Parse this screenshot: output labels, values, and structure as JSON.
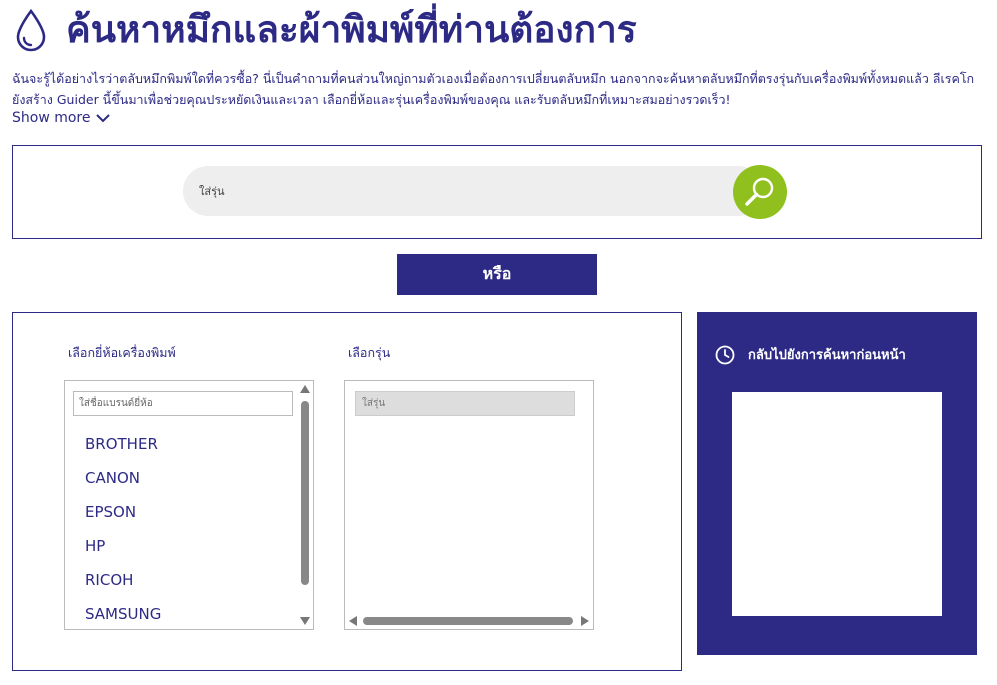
{
  "header": {
    "title": "ค้นหาหมึกและผ้าพิมพ์ที่ท่านต้องการ"
  },
  "intro": {
    "text": "ฉันจะรู้ได้อย่างไรว่าตลับหมึกพิมพ์ใดที่ควรซื้อ?    นี่เป็นคำถามที่คนส่วนใหญ่ถามตัวเองเมื่อต้องการเปลี่ยนตลับหมึก    นอกจากจะค้นหาตลับหมึกที่ตรงรุ่นกับเครื่องพิมพ์ทั้งหมดแล้ว ลีเรคโกยังสร้าง Guider นี้ขึ้นมาเพื่อช่วยคุณประหยัดเงินและเวลา เลือกยี่ห้อและรุ่นเครื่องพิมพ์ของคุณ และรับตลับหมึกที่เหมาะสมอย่างรวดเร็ว!",
    "show_more": "Show more"
  },
  "search": {
    "placeholder": "ใส่รุ่น"
  },
  "or_button": "หรือ",
  "brand_select": {
    "label": "เลือกยี่ห้อเครื่องพิมพ์",
    "placeholder": "ใส่ชื่อแบรนด์ยี่ห้อ",
    "items": [
      "BROTHER",
      "CANON",
      "EPSON",
      "HP",
      "RICOH",
      "SAMSUNG"
    ]
  },
  "model_select": {
    "label": "เลือกรุ่น",
    "placeholder": "ใส่รุ่น"
  },
  "history": {
    "title": "กลับไปยังการค้นหาก่อนหน้า"
  },
  "colors": {
    "brand": "#2d2a86",
    "accent": "#8fc01e",
    "pill": "#eeeeee"
  },
  "icons": {
    "header": "drop-icon",
    "search": "magnifier-icon",
    "show_more": "chevron-down-icon",
    "history": "clock-icon"
  }
}
